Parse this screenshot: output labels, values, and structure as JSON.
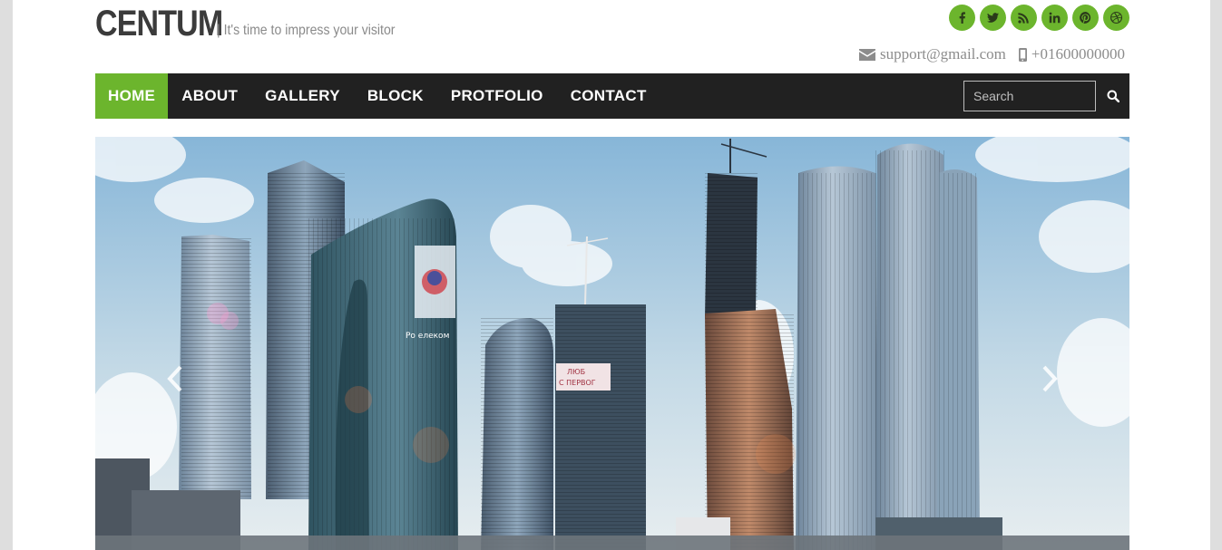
{
  "brand": {
    "logo": "CENTUM",
    "tagline": "| It's time to impress your visitor"
  },
  "social": [
    {
      "name": "facebook-icon"
    },
    {
      "name": "twitter-icon"
    },
    {
      "name": "rss-icon"
    },
    {
      "name": "linkedin-icon"
    },
    {
      "name": "pinterest-icon"
    },
    {
      "name": "dribbble-icon"
    }
  ],
  "contact": {
    "email": "support@gmail.com",
    "phone": "+01600000000"
  },
  "nav": {
    "items": [
      {
        "label": "HOME",
        "active": true
      },
      {
        "label": "ABOUT"
      },
      {
        "label": "GALLERY"
      },
      {
        "label": "BLOCK"
      },
      {
        "label": "PROTFOLIO"
      },
      {
        "label": "CONTACT"
      }
    ],
    "search_placeholder": "Search"
  },
  "colors": {
    "accent": "#6cb52d",
    "nav_bg": "#212121",
    "outer_bg": "#dedede"
  },
  "hero": {
    "sign_text_1": "ЛЮБ",
    "sign_text_2": "С ПЕРВОГ",
    "tower_text": "Ро  елеком"
  }
}
